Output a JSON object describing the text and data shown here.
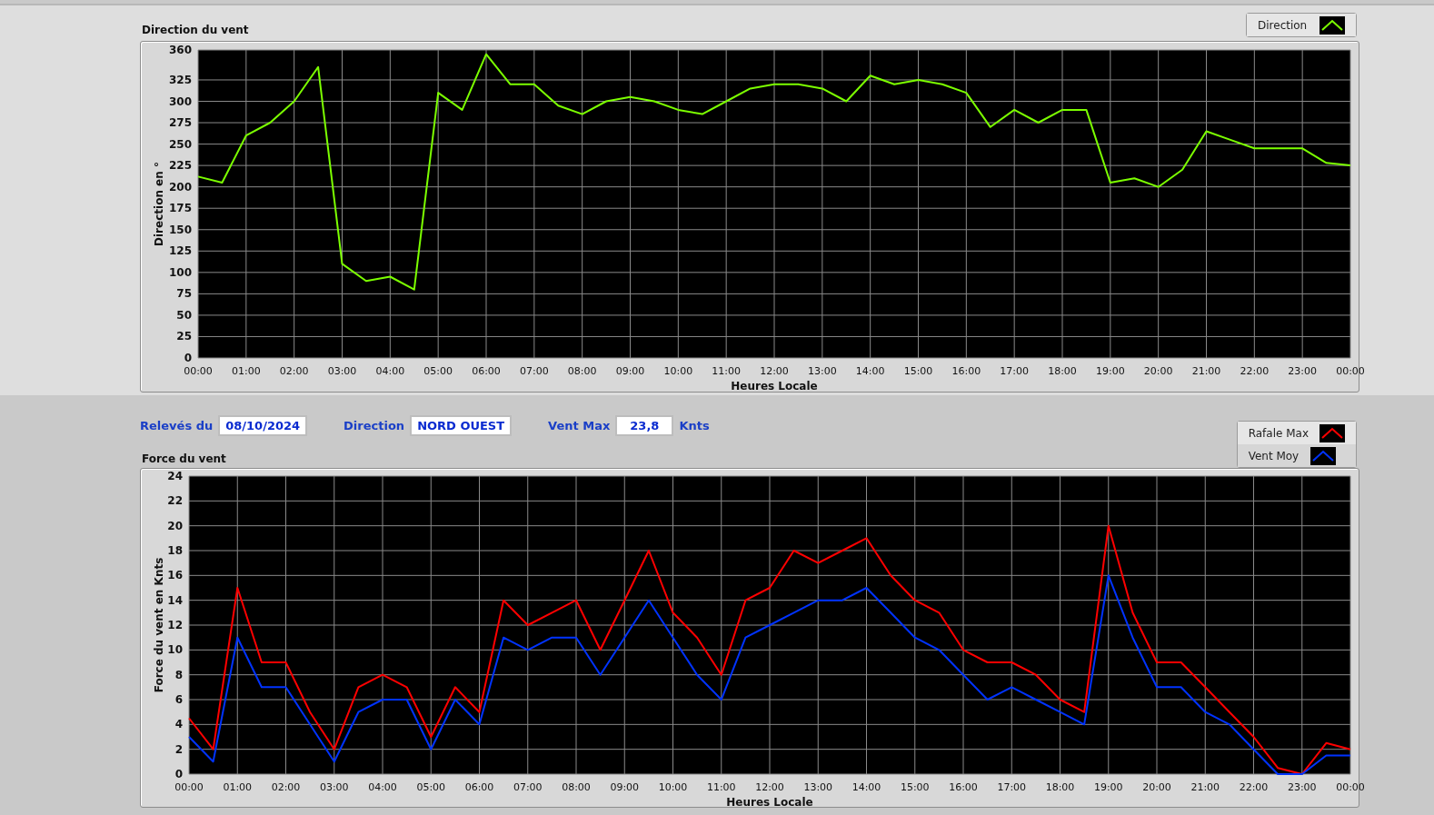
{
  "direction_panel": {
    "title": "Direction du vent",
    "chart_data": {
      "type": "line",
      "grid": true,
      "xlabel": "Heures Locale",
      "ylabel": "Direction en °",
      "x": [
        0,
        0.5,
        1,
        1.5,
        2,
        2.5,
        3,
        3.5,
        4,
        4.5,
        5,
        5.5,
        6,
        6.5,
        7,
        7.5,
        8,
        8.5,
        9,
        9.5,
        10,
        10.5,
        11,
        11.5,
        12,
        12.5,
        13,
        13.5,
        14,
        14.5,
        15,
        15.5,
        16,
        16.5,
        17,
        17.5,
        18,
        18.5,
        19,
        19.5,
        20,
        20.5,
        21,
        21.5,
        22,
        22.5,
        23,
        23.5,
        24
      ],
      "series": [
        {
          "name": "Direction",
          "color": "#7cff00",
          "values": [
            212,
            205,
            260,
            275,
            300,
            340,
            110,
            90,
            95,
            80,
            310,
            290,
            355,
            320,
            320,
            295,
            285,
            300,
            305,
            300,
            290,
            285,
            300,
            315,
            320,
            320,
            315,
            300,
            330,
            320,
            325,
            320,
            310,
            270,
            290,
            275,
            290,
            290,
            205,
            210,
            200,
            220,
            265,
            255,
            245,
            245,
            245,
            228,
            225
          ]
        }
      ],
      "xlim": [
        0,
        24
      ],
      "ylim": [
        0,
        360
      ],
      "xticks": [
        {
          "value": 0,
          "label": "00:00"
        },
        {
          "value": 1,
          "label": "01:00"
        },
        {
          "value": 2,
          "label": "02:00"
        },
        {
          "value": 3,
          "label": "03:00"
        },
        {
          "value": 4,
          "label": "04:00"
        },
        {
          "value": 5,
          "label": "05:00"
        },
        {
          "value": 6,
          "label": "06:00"
        },
        {
          "value": 7,
          "label": "07:00"
        },
        {
          "value": 8,
          "label": "08:00"
        },
        {
          "value": 9,
          "label": "09:00"
        },
        {
          "value": 10,
          "label": "10:00"
        },
        {
          "value": 11,
          "label": "11:00"
        },
        {
          "value": 12,
          "label": "12:00"
        },
        {
          "value": 13,
          "label": "13:00"
        },
        {
          "value": 14,
          "label": "14:00"
        },
        {
          "value": 15,
          "label": "15:00"
        },
        {
          "value": 16,
          "label": "16:00"
        },
        {
          "value": 17,
          "label": "17:00"
        },
        {
          "value": 18,
          "label": "18:00"
        },
        {
          "value": 19,
          "label": "19:00"
        },
        {
          "value": 20,
          "label": "20:00"
        },
        {
          "value": 21,
          "label": "21:00"
        },
        {
          "value": 22,
          "label": "22:00"
        },
        {
          "value": 23,
          "label": "23:00"
        },
        {
          "value": 24,
          "label": "00:00"
        }
      ],
      "yticks": [
        0,
        25,
        50,
        75,
        100,
        125,
        150,
        175,
        200,
        225,
        250,
        275,
        300,
        325,
        360
      ]
    }
  },
  "readings": [
    {
      "label": "Relevés du",
      "value": "08/10/2024"
    },
    {
      "label": "Direction",
      "value": "NORD OUEST"
    },
    {
      "label": "Vent Max",
      "value": "23,8",
      "unit": "Knts"
    }
  ],
  "force_panel": {
    "title": "Force du vent",
    "chart_data": {
      "type": "line",
      "grid": true,
      "xlabel": "Heures Locale",
      "ylabel": "Force du vent en Knts",
      "x": [
        0,
        0.5,
        1,
        1.5,
        2,
        2.5,
        3,
        3.5,
        4,
        4.5,
        5,
        5.5,
        6,
        6.5,
        7,
        7.5,
        8,
        8.5,
        9,
        9.5,
        10,
        10.5,
        11,
        11.5,
        12,
        12.5,
        13,
        13.5,
        14,
        14.5,
        15,
        15.5,
        16,
        16.5,
        17,
        17.5,
        18,
        18.5,
        19,
        19.5,
        20,
        20.5,
        21,
        21.5,
        22,
        22.5,
        23,
        23.5,
        24
      ],
      "series": [
        {
          "name": "Rafale Max",
          "color": "#ff0000",
          "values": [
            4.5,
            2,
            15,
            9,
            9,
            5,
            2,
            7,
            8,
            7,
            3,
            7,
            5,
            14,
            12,
            13,
            14,
            10,
            14,
            18,
            13,
            11,
            8,
            14,
            15,
            18,
            17,
            18,
            19,
            16,
            14,
            13,
            10,
            9,
            9,
            8,
            6,
            5,
            20,
            13,
            9,
            9,
            7,
            5,
            3,
            0.5,
            0,
            2.5,
            2
          ]
        },
        {
          "name": "Vent Moy",
          "color": "#0033ff",
          "values": [
            3,
            1,
            11,
            7,
            7,
            4,
            1,
            5,
            6,
            6,
            2,
            6,
            4,
            11,
            10,
            11,
            11,
            8,
            11,
            14,
            11,
            8,
            6,
            11,
            12,
            13,
            14,
            14,
            15,
            13,
            11,
            10,
            8,
            6,
            7,
            6,
            5,
            4,
            16,
            11,
            7,
            7,
            5,
            4,
            2,
            0,
            0,
            1.5,
            1.5
          ]
        }
      ],
      "xlim": [
        0,
        24
      ],
      "ylim": [
        0,
        24
      ],
      "xticks": [
        {
          "value": 0,
          "label": "00:00"
        },
        {
          "value": 1,
          "label": "01:00"
        },
        {
          "value": 2,
          "label": "02:00"
        },
        {
          "value": 3,
          "label": "03:00"
        },
        {
          "value": 4,
          "label": "04:00"
        },
        {
          "value": 5,
          "label": "05:00"
        },
        {
          "value": 6,
          "label": "06:00"
        },
        {
          "value": 7,
          "label": "07:00"
        },
        {
          "value": 8,
          "label": "08:00"
        },
        {
          "value": 9,
          "label": "09:00"
        },
        {
          "value": 10,
          "label": "10:00"
        },
        {
          "value": 11,
          "label": "11:00"
        },
        {
          "value": 12,
          "label": "12:00"
        },
        {
          "value": 13,
          "label": "13:00"
        },
        {
          "value": 14,
          "label": "14:00"
        },
        {
          "value": 15,
          "label": "15:00"
        },
        {
          "value": 16,
          "label": "16:00"
        },
        {
          "value": 17,
          "label": "17:00"
        },
        {
          "value": 18,
          "label": "18:00"
        },
        {
          "value": 19,
          "label": "19:00"
        },
        {
          "value": 20,
          "label": "20:00"
        },
        {
          "value": 21,
          "label": "21:00"
        },
        {
          "value": 22,
          "label": "22:00"
        },
        {
          "value": 23,
          "label": "23:00"
        },
        {
          "value": 24,
          "label": "00:00"
        }
      ],
      "yticks": [
        0,
        2,
        4,
        6,
        8,
        10,
        12,
        14,
        16,
        18,
        20,
        22,
        24
      ]
    }
  }
}
